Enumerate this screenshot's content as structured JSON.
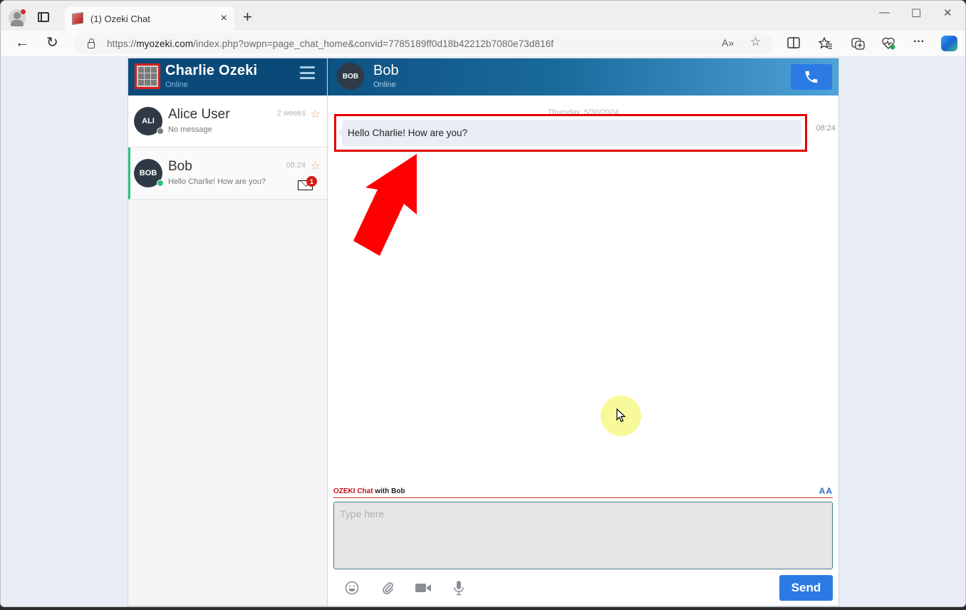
{
  "browser": {
    "tab_title": "(1) Ozeki Chat",
    "tab_close": "×",
    "new_tab": "+",
    "url_prefix": "https://",
    "url_domain": "myozeki.com",
    "url_path": "/index.php?owpn=page_chat_home&convid=7785189ff0d18b42212b7080e73d816f",
    "window_controls": {
      "minimize": "—",
      "maximize": "☐",
      "close": "✕"
    },
    "toolbar_icons": [
      "read-aloud-icon",
      "favorite-star-icon",
      "split-screen-icon",
      "favorites-icon",
      "collections-icon",
      "browser-essentials-icon",
      "more-icon",
      "copilot-icon"
    ],
    "nav": {
      "back": "←",
      "refresh": "↻"
    },
    "read_aloud": "A»",
    "favorite": "☆",
    "more": "···"
  },
  "sidebar": {
    "user_name": "Charlie Ozeki",
    "user_status": "Online",
    "contacts": [
      {
        "initials": "ALI",
        "name": "Alice User",
        "last_message": "No message",
        "time": "2 weeks",
        "presence_color": "#7a7f86",
        "active": false,
        "unread": null
      },
      {
        "initials": "BOB",
        "name": "Bob",
        "last_message": "Hello Charlie! How are you?",
        "time": "08:24",
        "presence_color": "#2ec27e",
        "active": true,
        "unread": "1"
      }
    ]
  },
  "chat": {
    "contact_initials": "BOB",
    "contact_name": "Bob",
    "contact_status": "Online",
    "date_separator": "Thursday, 5/30/2024",
    "messages": [
      {
        "text": "Hello Charlie! How are you?",
        "time": "08:24",
        "direction": "incoming"
      }
    ],
    "compose_brand": "OZEKI Chat",
    "compose_with": " with Bob",
    "font_toggle": "AA",
    "compose_placeholder": "Type here",
    "compose_value": "",
    "send_label": "Send",
    "tools": [
      "emoji-icon",
      "attachment-icon",
      "video-icon",
      "microphone-icon"
    ]
  },
  "colors": {
    "header_dark": "#0b4a78",
    "accent_blue": "#2c7be5",
    "online_green": "#2ec27e",
    "annotation_red": "#e50000",
    "brand_red": "#c1121f"
  }
}
